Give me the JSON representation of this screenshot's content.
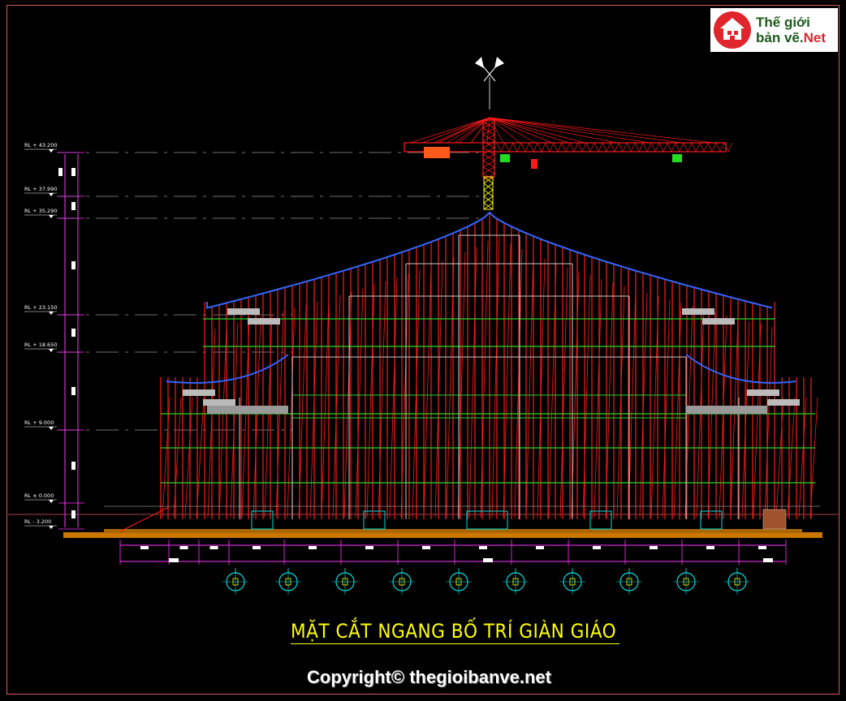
{
  "title": "MẶT CẮT NGANG BỐ TRÍ GIÀN GIÁO",
  "copyright": "Copyright© thegioibanve.net",
  "logo": {
    "line1": "Thế giới",
    "line2_a": "bản vẽ.",
    "line2_b": "Net"
  },
  "levels": [
    {
      "label": "RL + 43.200",
      "key": "rl-43200"
    },
    {
      "label": "RL + 37.990",
      "key": "rl-37990"
    },
    {
      "label": "RL + 35.290",
      "key": "rl-35290"
    },
    {
      "label": "RL + 23.150",
      "key": "rl-23150"
    },
    {
      "label": "RL + 18.650",
      "key": "rl-18650"
    },
    {
      "label": "RL + 9.000",
      "key": "rl-9000"
    },
    {
      "label": "RL ± 0.000",
      "key": "rl-0000"
    },
    {
      "label": "RL - 3.200",
      "key": "rl-m3200"
    }
  ],
  "colors": {
    "scaffold": "#ff1a1a",
    "ledger": "#22dd22",
    "roof": "#3366ff",
    "dimension": "#ff33ff",
    "grid_bubble": "#00dddd",
    "ground": "#cc7700",
    "structure": "#cccccc",
    "crane_mast": "#ffff00",
    "title": "#ffff00"
  },
  "icons": [
    "house-logo-icon",
    "flag-finial-icon",
    "tower-crane-icon"
  ]
}
